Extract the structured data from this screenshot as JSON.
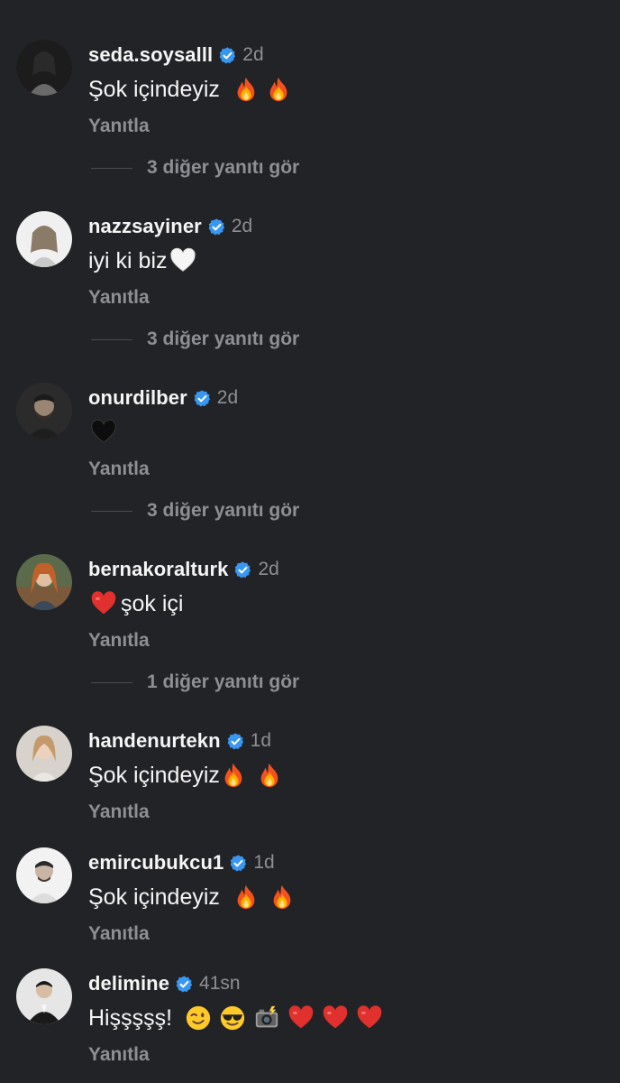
{
  "comments": [
    {
      "username": "seda.soysalll",
      "time": "2d",
      "text": "Şok içindeyiz",
      "emojis": [
        "fire",
        "fire"
      ],
      "reply": "Yanıtla",
      "more": "3 diğer yanıtı gör"
    },
    {
      "username": "nazzsayiner",
      "time": "2d",
      "text": "iyi ki biz",
      "emojis": [
        "white-heart"
      ],
      "reply": "Yanıtla",
      "more": "3 diğer yanıtı gör"
    },
    {
      "username": "onurdilber",
      "time": "2d",
      "text": "",
      "emojis": [
        "black-heart"
      ],
      "reply": "Yanıtla",
      "more": "3 diğer yanıtı gör"
    },
    {
      "username": "bernakoralturk",
      "time": "2d",
      "text": "şok içi",
      "emojis_before": [
        "red-heart"
      ],
      "reply": "Yanıtla",
      "more": "1 diğer yanıtı gör"
    },
    {
      "username": "handenurtekn",
      "time": "1d",
      "text": "Şok içindeyiz",
      "emojis": [
        "fire",
        "fire"
      ],
      "reply": "Yanıtla"
    },
    {
      "username": "emircubukcu1",
      "time": "1d",
      "text": "Şok içindeyiz",
      "emojis": [
        "fire",
        "fire"
      ],
      "reply": "Yanıtla"
    },
    {
      "username": "delimine",
      "time": "41sn",
      "text": "Hişşşşş!",
      "emojis": [
        "wink",
        "sunglasses",
        "camera-flash",
        "red-heart",
        "red-heart",
        "red-heart"
      ],
      "reply": "Yanıtla"
    }
  ],
  "colors": {
    "background": "#222327",
    "verified": "#3897f0",
    "primary_text": "#f5f5f5",
    "secondary_text": "#8e8f94"
  }
}
